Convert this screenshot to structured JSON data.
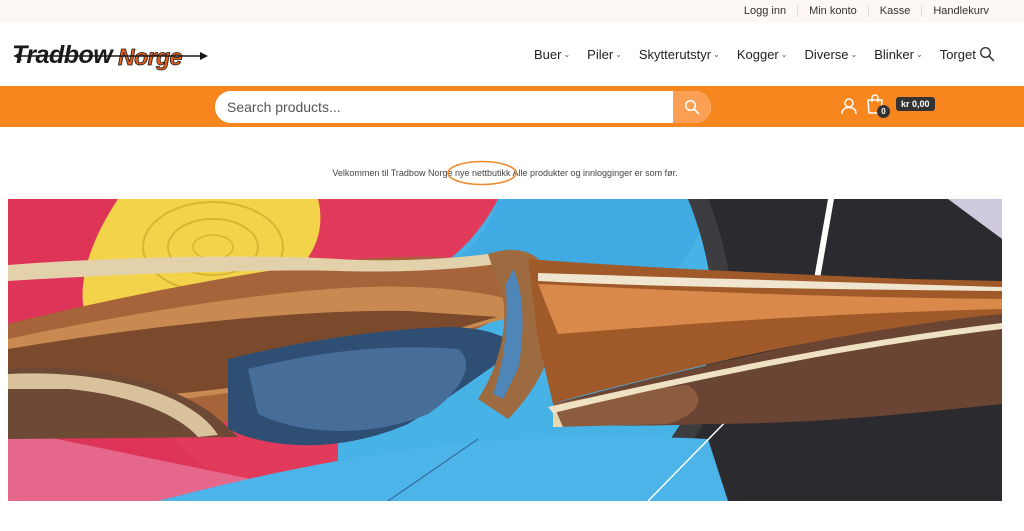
{
  "topbar": {
    "links": [
      "Logg inn",
      "Min konto",
      "Kasse",
      "Handlekurv"
    ]
  },
  "header": {
    "logo_text": "Tradbow Norge",
    "nav": [
      "Buer",
      "Piler",
      "Skytterutstyr",
      "Kogger",
      "Diverse",
      "Blinker",
      "Torget"
    ],
    "nav_has_dropdown": [
      true,
      true,
      true,
      true,
      true,
      true,
      false
    ]
  },
  "searchbar": {
    "placeholder": "Search products..."
  },
  "cart": {
    "count": "0",
    "total": "kr 0,00"
  },
  "welcome": {
    "text": "Velkommen til Tradbow Norge nye nettbutikk Alle produkter og innlogginger er som før."
  },
  "colors": {
    "accent": "#f7861f",
    "search_button": "#fb9f55",
    "logo_orange": "#e8611a"
  },
  "icons": {
    "header_search": "search-icon",
    "search_button": "search-icon",
    "account": "user-icon",
    "cart": "shopping-bag-icon"
  }
}
